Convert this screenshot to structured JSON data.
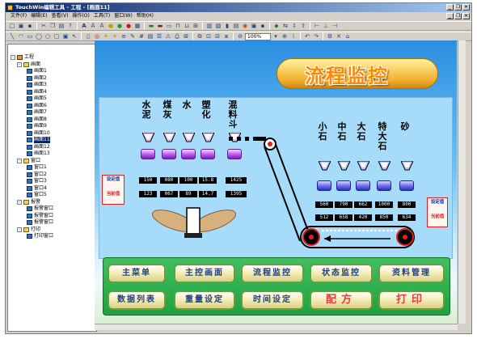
{
  "window": {
    "title": "TouchWin编辑工具 - 工程 - [画面11]",
    "controls": [
      "_",
      "❐",
      "✕"
    ]
  },
  "menu": [
    "文件(F)",
    "编辑(E)",
    "查看(V)",
    "操作(O)",
    "工具(T)",
    "窗口(W)",
    "帮助(H)"
  ],
  "toolbar": {
    "zoom": "100%"
  },
  "tree": {
    "root": "工程",
    "screens_label": "画面",
    "screens": [
      "画面1",
      "画面2",
      "画面3",
      "画面4",
      "画面5",
      "画面6",
      "画面7",
      "画面8",
      "画面9",
      "画面10",
      "画面11",
      "画面12",
      "画面13"
    ],
    "selected": "画面11",
    "windows_label": "窗口",
    "windows": [
      "窗口1",
      "窗口2",
      "窗口3",
      "窗口4",
      "窗口5"
    ],
    "alarm_label": "报警",
    "alarms": [
      "报警窗口",
      "报警窗口",
      "报警窗口"
    ],
    "print_label": "打印",
    "prints": [
      "打印窗口"
    ]
  },
  "screen": {
    "title": "流程监控",
    "left_materials": [
      "水泥",
      "煤灰",
      "水",
      "塑化",
      "混料斗"
    ],
    "right_materials": [
      "小石",
      "中石",
      "大石",
      "特大石",
      "砂"
    ],
    "set_label": "设定值",
    "current_label": "当前值",
    "left_set": [
      "150",
      "080",
      "100",
      "15.8",
      "1425"
    ],
    "left_current": [
      "123",
      "067",
      "89",
      "14.7",
      "1395"
    ],
    "right_set": [
      "560",
      "790",
      "662",
      "1000",
      "800"
    ],
    "right_current": [
      "512",
      "658",
      "420",
      "850",
      "634"
    ],
    "buttons_row1": [
      "主菜单",
      "主控画面",
      "流程监控",
      "状态监控",
      "资料管理"
    ],
    "buttons_row2": [
      "数据列表",
      "重量设定",
      "时间设定",
      "配方",
      "打印"
    ]
  },
  "colors": {
    "title_text": "#ff8800",
    "button_text": "#204080",
    "big_button_text": "#e04040"
  }
}
